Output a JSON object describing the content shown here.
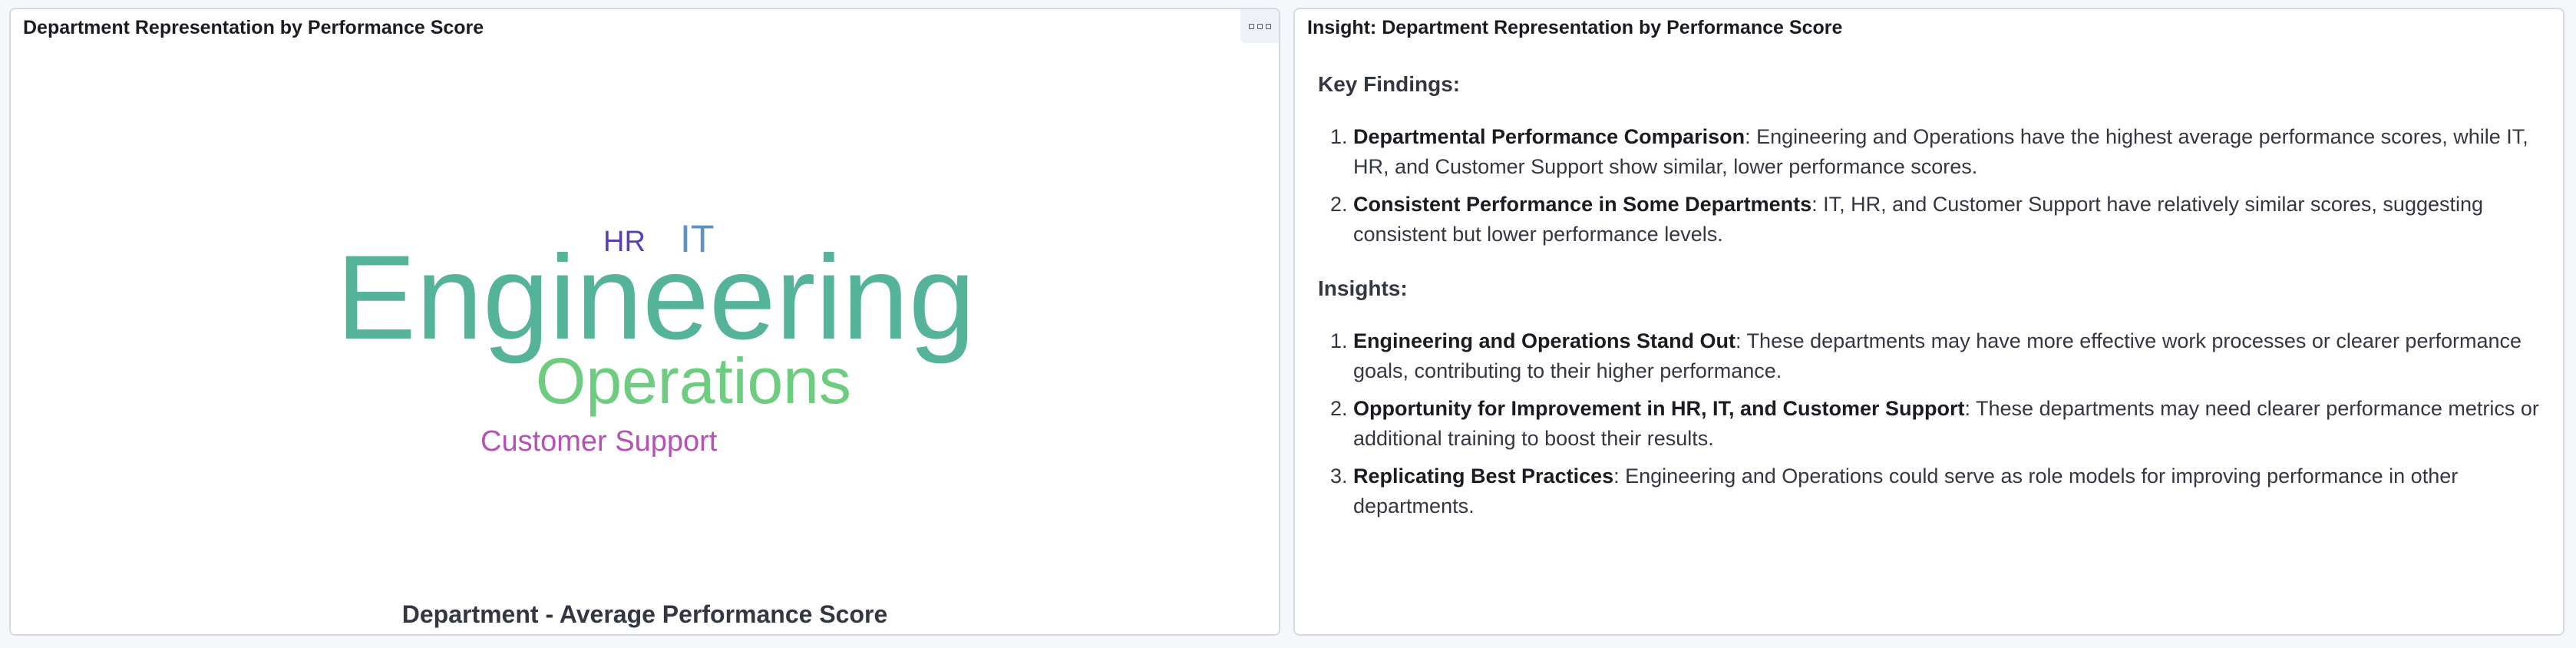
{
  "left_panel": {
    "title": "Department Representation by Performance Score",
    "caption": "Department - Average Performance Score",
    "words": {
      "engineering": "Engineering",
      "operations": "Operations",
      "it": "IT",
      "hr": "HR",
      "customer_support": "Customer Support"
    },
    "colors": {
      "engineering": "#54b399",
      "operations": "#6dcc7f",
      "it": "#6092c0",
      "hr": "#5a3eb5",
      "customer_support": "#b552b3"
    },
    "options_icon": "panel-options-icon"
  },
  "right_panel": {
    "title": "Insight: Department Representation by Performance Score",
    "key_findings_heading": "Key Findings:",
    "key_findings": [
      {
        "title": "Departmental Performance Comparison",
        "text": ": Engineering and Operations have the highest average performance scores, while IT, HR, and Customer Support show similar, lower performance scores."
      },
      {
        "title": "Consistent Performance in Some Departments",
        "text": ": IT, HR, and Customer Support have relatively similar scores, suggesting consistent but lower performance levels."
      }
    ],
    "insights_heading": "Insights:",
    "insights": [
      {
        "title": "Engineering and Operations Stand Out",
        "text": ": These departments may have more effective work processes or clearer performance goals, contributing to their higher performance."
      },
      {
        "title": "Opportunity for Improvement in HR, IT, and Customer Support",
        "text": ": These departments may need clearer performance metrics or additional training to boost their results."
      },
      {
        "title": "Replicating Best Practices",
        "text": ": Engineering and Operations could serve as role models for improving performance in other departments."
      }
    ]
  }
}
